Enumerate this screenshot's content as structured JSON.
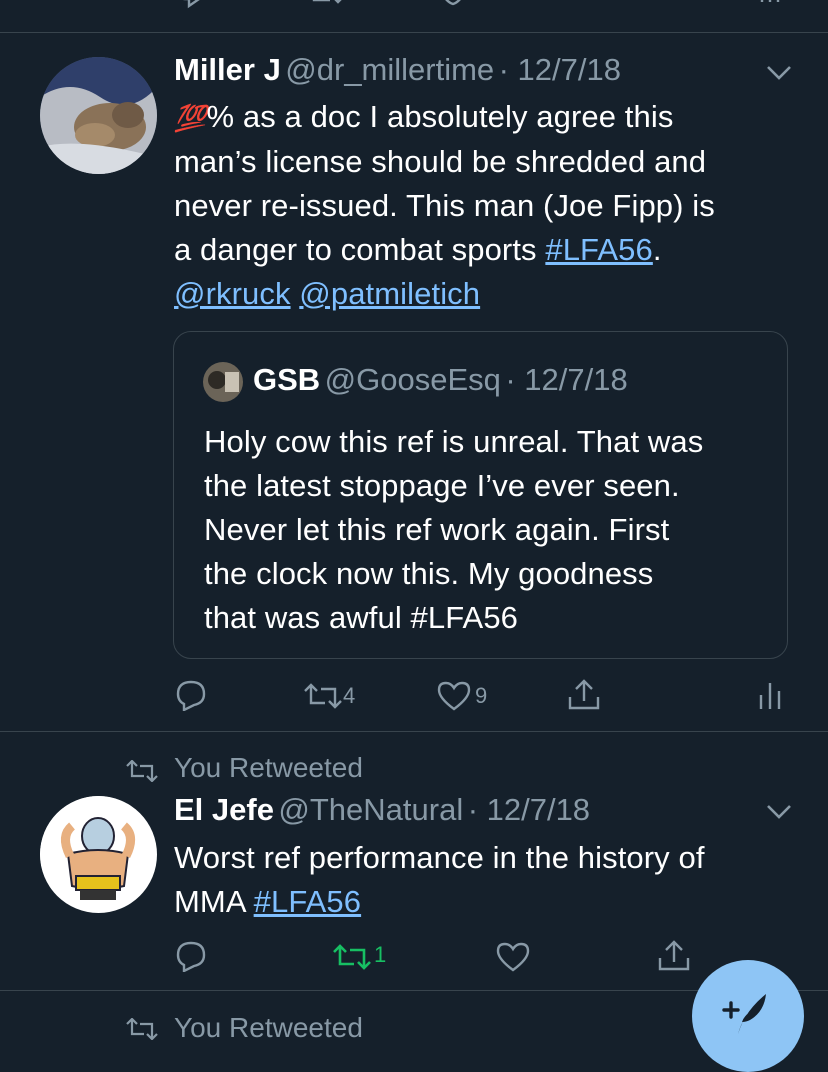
{
  "top_action_bar": {
    "visible": true
  },
  "tweets": [
    {
      "name": "Miller J",
      "handle": "@dr_millertime",
      "date": "· 12/7/18",
      "emoji_text": "💯",
      "body_lines": [
        "% as a doc I absolutely agree this",
        "man’s license should be shredded and",
        "never re-issued.  This man (Joe Fipp)  is",
        "a danger to combat sports "
      ],
      "hashtag": "#LFA56",
      "after_hashtag": ".",
      "mention1": "@rkruck",
      "mention2": "@patmiletich",
      "quote": {
        "name": "GSB",
        "handle": "@GooseEsq",
        "date": "· 12/7/18",
        "lines": [
          "Holy cow this ref is unreal. That was",
          "the latest stoppage I’ve ever seen.",
          "Never let this ref work again. First",
          "the clock now this. My goodness",
          "that was awful  #LFA56"
        ]
      },
      "actions": {
        "reply": "",
        "retweet": "4",
        "like": "9"
      }
    },
    {
      "retweeted_label": "You Retweeted",
      "name": "El Jefe",
      "handle": "@TheNatural",
      "date": "· 12/7/18",
      "body_lines": [
        "Worst ref performance in the history of",
        "MMA "
      ],
      "hashtag": "#LFA56",
      "actions": {
        "retweet": "1"
      }
    }
  ],
  "next_retweeted_label": "You Retweeted",
  "colors": {
    "background": "#15202b",
    "separator": "#38444d",
    "muted": "#8899a6",
    "link": "#1da1f2",
    "retweet_green": "#17bf63",
    "fab": "#8ec5f5"
  },
  "icons": [
    "chevron-down-icon",
    "reply-icon",
    "retweet-icon",
    "like-icon",
    "share-icon",
    "analytics-icon",
    "compose-tweet-icon"
  ]
}
